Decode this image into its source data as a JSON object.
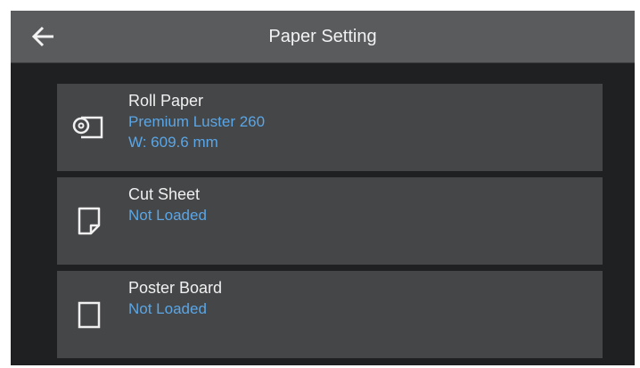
{
  "header": {
    "title": "Paper Setting",
    "back_icon": "back-arrow-icon"
  },
  "colors": {
    "background": "#1f2022",
    "header": "#5a5b5d",
    "item": "#454648",
    "accent": "#5aa6e6",
    "text": "#f0f0f0"
  },
  "sources": [
    {
      "name": "Roll Paper",
      "icon": "roll-paper-icon",
      "media": "Premium Luster 260",
      "width": "W: 609.6 mm"
    },
    {
      "name": "Cut Sheet",
      "icon": "cut-sheet-icon",
      "status": "Not Loaded"
    },
    {
      "name": "Poster Board",
      "icon": "poster-board-icon",
      "status": "Not Loaded"
    }
  ]
}
